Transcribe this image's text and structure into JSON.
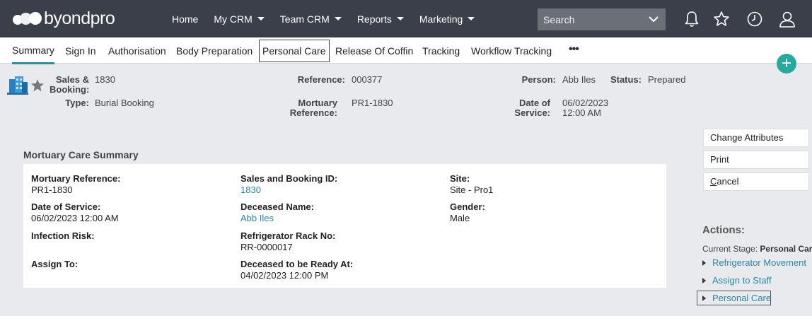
{
  "brand": {
    "name": "byondpro"
  },
  "nav": {
    "items": [
      {
        "label": "Home",
        "dropdown": false
      },
      {
        "label": "My CRM",
        "dropdown": true
      },
      {
        "label": "Team CRM",
        "dropdown": true
      },
      {
        "label": "Reports",
        "dropdown": true
      },
      {
        "label": "Marketing",
        "dropdown": true
      }
    ],
    "search_placeholder": "Search",
    "icons": [
      "bell-icon",
      "star-icon",
      "clock-icon",
      "user-icon"
    ]
  },
  "tabs": {
    "items": [
      "Summary",
      "Sign In",
      "Authorisation",
      "Body Preparation",
      "Personal Care",
      "Release Of Coffin",
      "Tracking",
      "Workflow Tracking"
    ],
    "active": "Summary",
    "focused": "Personal Care",
    "more": "•••"
  },
  "header": {
    "sales_booking_label": "Sales & Booking:",
    "sales_booking_value": "1830",
    "type_label": "Type:",
    "type_value": "Burial Booking",
    "reference_label": "Reference:",
    "reference_value": "000377",
    "mortuary_ref_label": "Mortuary Reference:",
    "mortuary_ref_value": "PR1-1830",
    "person_label": "Person:",
    "person_value": "Abb Iles",
    "status_label": "Status:",
    "status_value": "Prepared",
    "date_service_label": "Date of Service:",
    "date_service_value_1": "06/02/2023",
    "date_service_value_2": "12:00 AM"
  },
  "summary": {
    "title": "Mortuary Care Summary",
    "fields": {
      "mortuary_reference": {
        "label": "Mortuary Reference:",
        "value": "PR1-1830"
      },
      "sales_booking_id": {
        "label": "Sales and Booking ID:",
        "value": "1830"
      },
      "site": {
        "label": "Site:",
        "value": "Site - Pro1"
      },
      "date_of_service": {
        "label": "Date of Service:",
        "value": "06/02/2023 12:00 AM"
      },
      "deceased_name": {
        "label": "Deceased Name:",
        "value": "Abb Iles"
      },
      "gender": {
        "label": "Gender:",
        "value": "Male"
      },
      "infection_risk": {
        "label": "Infection Risk:",
        "value": ""
      },
      "refrigerator_rack": {
        "label": "Refrigerator Rack No:",
        "value": "RR-0000017"
      },
      "assign_to": {
        "label": "Assign To:",
        "value": ""
      },
      "ready_at": {
        "label": "Deceased to be Ready At:",
        "value": "04/02/2023 12:00 PM"
      }
    }
  },
  "side": {
    "buttons": [
      "Change Attributes",
      "Print",
      "Cancel"
    ],
    "actions_title": "Actions:",
    "current_stage_label": "Current Stage:",
    "current_stage_value": "Personal Care",
    "actions": [
      "Refrigerator Movement",
      "Assign to Staff",
      "Personal Care"
    ]
  },
  "colors": {
    "topbar": "#3a3f4a",
    "accent": "#2e8fa0",
    "link": "#2a86a8",
    "add_button": "#27a99e",
    "page_bg": "#e8eaed"
  }
}
